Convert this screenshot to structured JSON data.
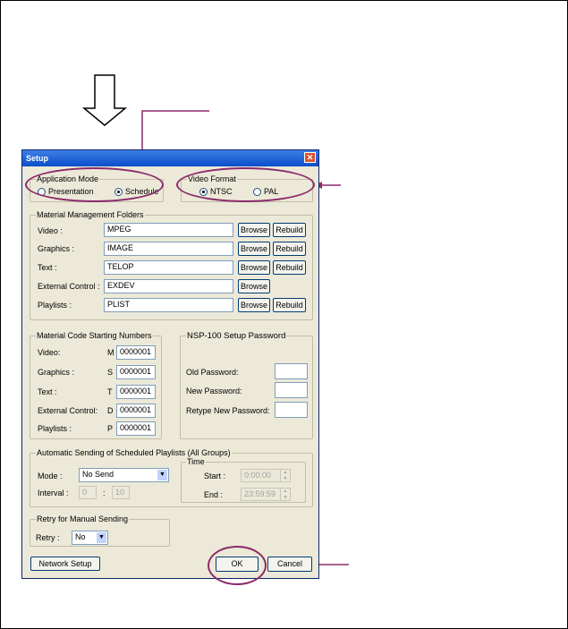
{
  "dialog": {
    "title": "Setup",
    "close_glyph": "✕",
    "application_mode": {
      "label": "Application Mode",
      "options": [
        "Presentation",
        "Schedule"
      ],
      "selected": "Schedule"
    },
    "video_format": {
      "label": "Video Format",
      "options": [
        "NTSC",
        "PAL"
      ],
      "selected": "NTSC"
    },
    "material_folders": {
      "label": "Material Management Folders",
      "rows": [
        {
          "label": "Video :",
          "value": "MPEG",
          "browse": "Browse",
          "rebuild": "Rebuild"
        },
        {
          "label": "Graphics :",
          "value": "IMAGE",
          "browse": "Browse",
          "rebuild": "Rebuild"
        },
        {
          "label": "Text :",
          "value": "TELOP",
          "browse": "Browse",
          "rebuild": "Rebuild"
        },
        {
          "label": "External Control :",
          "value": "EXDEV",
          "browse": "Browse"
        },
        {
          "label": "Playlists :",
          "value": "PLIST",
          "browse": "Browse",
          "rebuild": "Rebuild"
        }
      ]
    },
    "code_numbers": {
      "label": "Material Code Starting Numbers",
      "rows": [
        {
          "label": "Video:",
          "prefix": "M",
          "value": "0000001"
        },
        {
          "label": "Graphics :",
          "prefix": "S",
          "value": "0000001"
        },
        {
          "label": "Text :",
          "prefix": "T",
          "value": "0000001"
        },
        {
          "label": "External Control:",
          "prefix": "D",
          "value": "0000001"
        },
        {
          "label": "Playlists :",
          "prefix": "P",
          "value": "0000001"
        }
      ]
    },
    "password": {
      "label": "NSP-100 Setup Password",
      "old": "Old Password:",
      "new": "New Password:",
      "retype": "Retype New Password:"
    },
    "auto_sending": {
      "label": "Automatic Sending of Scheduled Playlists (All Groups)",
      "mode_label": "Mode :",
      "mode_value": "No Send",
      "interval_label": "Interval :",
      "interval_value1": "0",
      "interval_sep": ":",
      "interval_value2": "10",
      "time_label": "Time",
      "start_label": "Start :",
      "start_value": "0:00:00",
      "end_label": "End :",
      "end_value": "23:59:59"
    },
    "retry": {
      "label": "Retry for Manual Sending",
      "retry_label": "Retry :",
      "retry_value": "No"
    },
    "buttons": {
      "network_setup": "Network Setup",
      "ok": "OK",
      "cancel": "Cancel"
    }
  },
  "annotation_color": "#8b2a6b"
}
